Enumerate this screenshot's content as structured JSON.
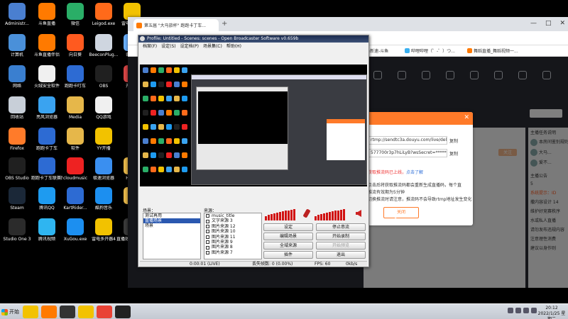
{
  "desktop": {
    "icons": [
      {
        "label": "Administr...",
        "glyph": "",
        "color": "#4a7fd0",
        "icon": "user-folder-icon"
      },
      {
        "label": "斗鱼直播",
        "glyph": "",
        "color": "#ff7a00",
        "icon": "douyu-icon"
      },
      {
        "label": "微信",
        "glyph": "",
        "color": "#2aae67",
        "icon": "wechat-icon"
      },
      {
        "label": "Leigod.exe",
        "glyph": "",
        "color": "#ff6a1a",
        "icon": "leigod-icon"
      },
      {
        "label": "雷电模拟器",
        "glyph": "",
        "color": "#f2c200",
        "icon": "ldplayer-icon"
      },
      {
        "label": "计算机",
        "glyph": "",
        "color": "#4a90d9",
        "icon": "computer-icon"
      },
      {
        "label": "斗鱼直播伴侣",
        "glyph": "",
        "color": "#ff7a00",
        "icon": "douyu-companion-icon"
      },
      {
        "label": "向日葵",
        "glyph": "",
        "color": "#ff5a1f",
        "icon": "sunlogin-icon"
      },
      {
        "label": "BeeconPlug...",
        "glyph": "",
        "color": "#cfd6e0",
        "icon": "bee-icon"
      },
      {
        "label": "奇妙...",
        "glyph": "",
        "color": "#6ab0ff",
        "icon": "app-icon"
      },
      {
        "label": "网络",
        "glyph": "",
        "color": "#3a7fd0",
        "icon": "network-icon"
      },
      {
        "label": "火绒安全软件",
        "glyph": "",
        "color": "#f0f0f0",
        "icon": "huorong-icon"
      },
      {
        "label": "跑跑卡叮车",
        "glyph": "",
        "color": "#2d6bd3",
        "icon": "kart-icon"
      },
      {
        "label": "OBS",
        "glyph": "",
        "color": "#202020",
        "icon": "obs-icon"
      },
      {
        "label": "开始...",
        "glyph": "",
        "color": "#d64545",
        "icon": "app-icon"
      },
      {
        "label": "回收站",
        "glyph": "",
        "color": "#c8cfd8",
        "icon": "recycle-bin-icon"
      },
      {
        "label": "亮风浏览器",
        "glyph": "",
        "color": "#3aa3f0",
        "icon": "browser-icon"
      },
      {
        "label": "Media",
        "glyph": "",
        "color": "#e6b74a",
        "icon": "folder-icon"
      },
      {
        "label": "QQ游戏",
        "glyph": "",
        "color": "#f0f0f0",
        "icon": "qq-game-icon"
      },
      {
        "label": "Firefox",
        "glyph": "",
        "color": "#ff7b2a",
        "icon": "firefox-icon"
      },
      {
        "label": "跑跑卡丁车",
        "glyph": "",
        "color": "#2d6bd3",
        "icon": "kart-icon"
      },
      {
        "label": "软件",
        "glyph": "",
        "color": "#e6b74a",
        "icon": "folder-icon"
      },
      {
        "label": "YY开播",
        "glyph": "",
        "color": "#f2c200",
        "icon": "yy-icon"
      },
      {
        "label": "OBS Studio",
        "glyph": "",
        "color": "#202020",
        "icon": "obs-studio-icon"
      },
      {
        "label": "跑跑卡丁车联赛版",
        "glyph": "",
        "color": "#2d6bd3",
        "icon": "kart-icon"
      },
      {
        "label": "cloudmusic",
        "glyph": "",
        "color": "#e22",
        "icon": "netease-music-icon"
      },
      {
        "label": "极速浏览器",
        "glyph": "",
        "color": "#3a8ff0",
        "icon": "browser-icon"
      },
      {
        "label": "Hist...",
        "glyph": "",
        "color": "#e6b74a",
        "icon": "folder-icon"
      },
      {
        "label": "Steam",
        "glyph": "",
        "color": "#1b2838",
        "icon": "steam-icon"
      },
      {
        "label": "腾讯QQ",
        "glyph": "",
        "color": "#1e9bf0",
        "icon": "qq-icon"
      },
      {
        "label": "KartRider...",
        "glyph": "",
        "color": "#2d6bd3",
        "icon": "kart-icon"
      },
      {
        "label": "酷狗音乐",
        "glyph": "",
        "color": "#1c8ff0",
        "icon": "kugou-icon"
      },
      {
        "label": "Ti...",
        "glyph": "",
        "color": "#e6b74a",
        "icon": "folder-icon"
      },
      {
        "label": "Studio One 3",
        "glyph": "",
        "color": "#2b2b2b",
        "icon": "studio-one-icon"
      },
      {
        "label": "腾讯视频",
        "glyph": "",
        "color": "#2fb5f0",
        "icon": "tencent-video-icon"
      },
      {
        "label": "XuGou.exe",
        "glyph": "",
        "color": "#1c8ff0",
        "icon": "kugou-icon"
      },
      {
        "label": "雷电多开器4",
        "glyph": "",
        "color": "#f2c200",
        "icon": "ldmulti-icon"
      },
      {
        "label": "直播效果 kong auto...",
        "glyph": "",
        "color": "#3a3a3a",
        "icon": "app-icon"
      }
    ]
  },
  "taskbar": {
    "start_label": "开始",
    "apps": [
      {
        "name": "douyu-task",
        "color": "#f2c200",
        "glyph": ""
      },
      {
        "name": "douyu-companion-task",
        "color": "#ff7a00",
        "glyph": ""
      },
      {
        "name": "studio-task",
        "color": "#333",
        "glyph": ""
      },
      {
        "name": "leigod-task",
        "color": "#f2c200",
        "glyph": ""
      },
      {
        "name": "chrome-task",
        "color": "#e94235",
        "glyph": ""
      },
      {
        "name": "obs-task",
        "color": "#222",
        "glyph": ""
      }
    ],
    "time": "20:12",
    "date": "2022/1/25 星期二"
  },
  "browser": {
    "tab_title": "第五届 \"大马旅杯\" 跑跑卡丁车...",
    "new_tab": "+",
    "window_controls": [
      "—",
      "□",
      "✕"
    ],
    "bookmarks": [
      {
        "label": "最新速-斗鱼",
        "color": "#ff7a00"
      },
      {
        "label": "哔哩哔哩（゜-゜）つ...",
        "color": "#3ab0f0"
      },
      {
        "label": "舞蹈直播_舞蹈视频一...",
        "color": "#ff7a00"
      }
    ],
    "nav": [
      "",
      "",
      "",
      "",
      "",
      "",
      "",
      ""
    ],
    "count": "140074",
    "badge": "关注",
    "scroll_button": "",
    "right_panel": {
      "lines": [
        "主播任务说明",
        "本房间鉴别规则由...",
        "大马...",
        "爱不...",
        "",
        "主播公告",
        "5",
        "系统提示：ID",
        "撒内容设计 14",
        "维护好竞赛秩序",
        "水或私人直播",
        "请勿发布违规内容",
        "注意理性消费",
        "建议以身作则"
      ]
    }
  },
  "dialog": {
    "field1": "rtmp://sendtc3a.douyu.com/live/delay",
    "field2": "577700r3p7hLiLyB?wsSecret=*********",
    "copy1": "复制",
    "copy2": "复制",
    "err_prefix": "获取推流码已上线，",
    "retry": "点击了解",
    "line1": "点击后将获取推流码都会重新生成直播码，每个直",
    "line2": "推流有效期为5分钟",
    "line3": "切换推流时请注意，推流码不会导致rtmp地址发生变化",
    "close_button": "关闭"
  },
  "obs": {
    "title": "Profile: Untitled - Scenes: scenes - Open Broadcaster Software v0.659b",
    "menu": [
      "档案(F)",
      "设定(S)",
      "设定档(P)",
      "场景集(C)",
      "帮助(H)"
    ],
    "scenes_label": "场景：",
    "sources_label": "来源：",
    "scenes": [
      {
        "label": "测试再用",
        "selected": false
      },
      {
        "label": "直播场景",
        "selected": true
      },
      {
        "label": "场景",
        "selected": false
      }
    ],
    "sources": [
      "music_title",
      "文字来源 3",
      "图片来源 12",
      "图片来源 10",
      "图片来源 11",
      "图片来源 9",
      "图片来源 8",
      "图片来源 7"
    ],
    "buttons": [
      {
        "label": "设定",
        "disabled": false
      },
      {
        "label": "停止串流",
        "disabled": false
      },
      {
        "label": "编辑场景",
        "disabled": false
      },
      {
        "label": "开始录制",
        "disabled": false
      },
      {
        "label": "全域来源",
        "disabled": false
      },
      {
        "label": "开始预览",
        "disabled": true
      },
      {
        "label": "插件",
        "disabled": false
      },
      {
        "label": "退出",
        "disabled": false
      }
    ],
    "status": {
      "time": "0:00:01 (LIVE)",
      "dropped": "丢失帧数: 0 (0.00%)",
      "fps": "FPS: 60",
      "kbps": "0kb/s"
    },
    "meter_levels": [
      0.35,
      0.5,
      0.55,
      0.6,
      0.7,
      0.75,
      0.8,
      0.85,
      0.9,
      0.95,
      1.0
    ],
    "colors": {
      "titlebar": "#1b2b4f",
      "meter": "#d11111",
      "selection": "#2a58b0"
    }
  },
  "colors": {
    "accent": "#ff7a29",
    "link": "#2f6fd8",
    "error": "#e33333"
  }
}
